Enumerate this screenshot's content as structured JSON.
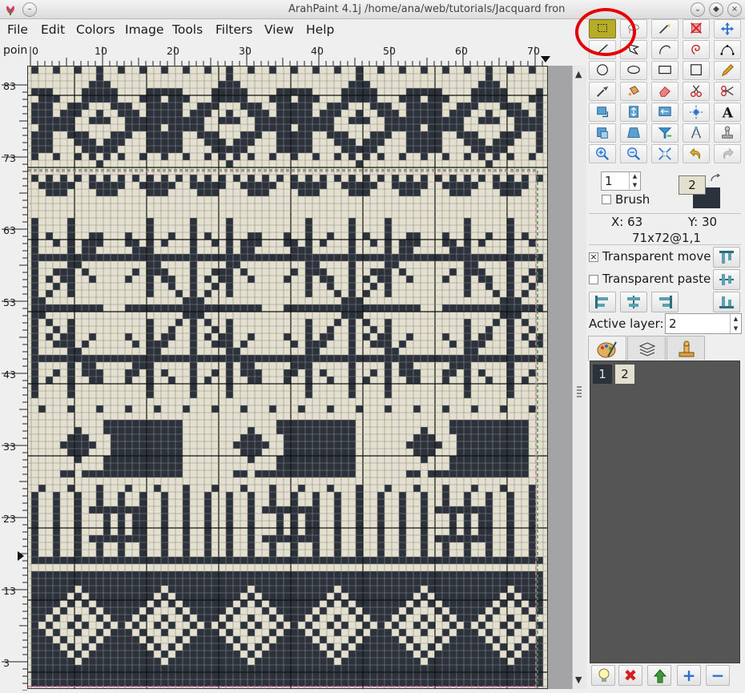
{
  "window": {
    "title": "ArahPaint 4.1j /home/ana/web/tutorials/Jacquard fron"
  },
  "menu": [
    "File",
    "Edit",
    "Colors",
    "Image",
    "Tools",
    "Filters",
    "View",
    "Help"
  ],
  "ruler": {
    "corner_label": "poin",
    "x_ticks": [
      "0",
      "10",
      "20",
      "30",
      "40",
      "50",
      "60",
      "70"
    ],
    "y_ticks": [
      "83",
      "73",
      "63",
      "53",
      "43",
      "33",
      "23",
      "13",
      "3"
    ]
  },
  "tools": {
    "icons": [
      [
        "select-rectangle-icon",
        "lasso-icon",
        "magic-wand-icon",
        "deselect-icon",
        "move-icon"
      ],
      [
        "line-icon",
        "polygon-icon",
        "curve-icon",
        "spiral-icon",
        "bezier-icon"
      ],
      [
        "ellipse-outline-icon",
        "ellipse-filled-icon",
        "rectangle-outline-icon",
        "square-icon",
        "pencil-icon"
      ],
      [
        "eyedropper-icon",
        "fill-icon",
        "eraser-icon",
        "cut-icon",
        "scissors-icon"
      ],
      [
        "rotate-icon",
        "flip-vertical-icon",
        "mirror-icon",
        "arrange-icon",
        "text-icon"
      ],
      [
        "crop-icon",
        "perspective-icon",
        "filter-icon",
        "compass-icon",
        "stamp-icon"
      ],
      [
        "zoom-in-icon",
        "zoom-out-icon",
        "zoom-fit-icon",
        "undo-icon",
        "redo-icon"
      ]
    ],
    "active": "select-rectangle-icon"
  },
  "brush": {
    "size": "1",
    "label": "Brush",
    "checked": false
  },
  "color": {
    "foreground_index": "2",
    "foreground": "#e4e0cf",
    "background": "#2b323c"
  },
  "status": {
    "x_text": "X: 63",
    "y_text": "Y: 30",
    "size_text": "71x72@1,1"
  },
  "options": {
    "transparent_move_label": "Transparent move",
    "transparent_move_checked": "×",
    "transparent_paste_label": "Transparent paste"
  },
  "layers": {
    "active_layer_label": "Active layer:",
    "active_layer_value": "2",
    "items": [
      "1",
      "2"
    ]
  },
  "canvas": {
    "light_color": "#e4e0cf",
    "dark_color": "#2b323c",
    "grid_color": "#8b8b88",
    "major_line_color": "#111111",
    "cols": 71,
    "rows": 86
  }
}
